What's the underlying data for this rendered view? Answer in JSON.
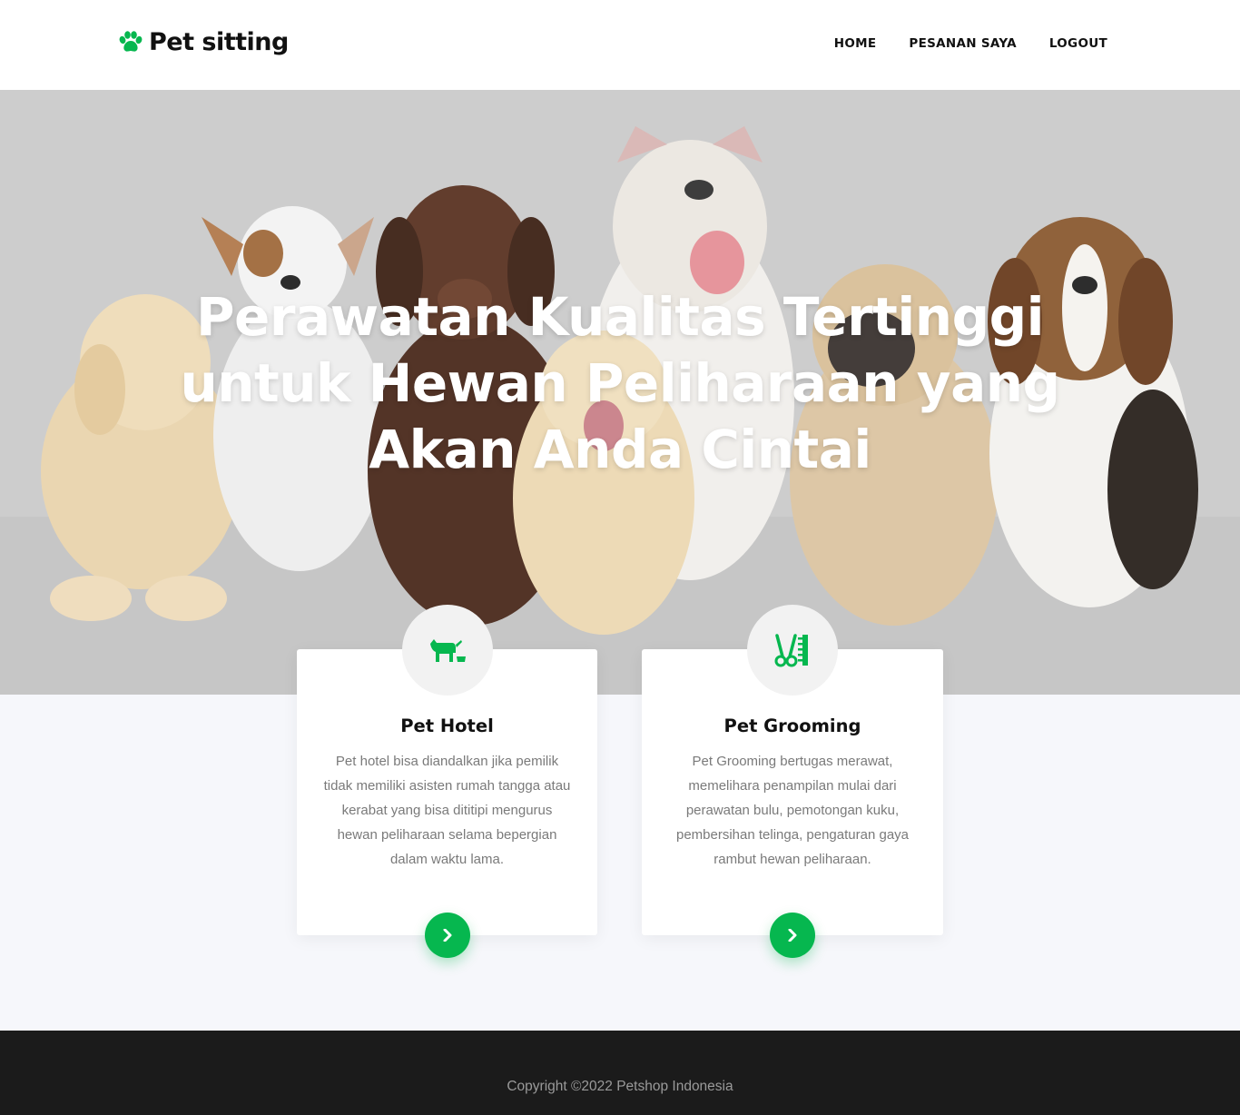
{
  "brand": {
    "name": "Pet sitting",
    "icon": "paw-icon",
    "accent": "#06b74f"
  },
  "nav": {
    "items": [
      {
        "label": "HOME"
      },
      {
        "label": "PESANAN SAYA"
      },
      {
        "label": "LOGOUT"
      }
    ]
  },
  "hero": {
    "title": "Perawatan Kualitas Tertinggi untuk Hewan Peliharaan yang Akan Anda Cintai"
  },
  "services": [
    {
      "title": "Pet Hotel",
      "icon": "dog-bowl-icon",
      "description": "Pet hotel bisa diandalkan jika pemilik tidak memiliki asisten rumah tangga atau kerabat yang bisa dititipi mengurus hewan peliharaan selama bepergian dalam waktu lama."
    },
    {
      "title": "Pet Grooming",
      "icon": "scissors-comb-icon",
      "description": "Pet Grooming bertugas merawat, memelihara penampilan mulai dari perawatan bulu, pemotongan kuku, pembersihan telinga, pengaturan gaya rambut hewan peliharaan."
    }
  ],
  "footer": {
    "copyright": "Copyright ©2022 Petshop Indonesia"
  }
}
